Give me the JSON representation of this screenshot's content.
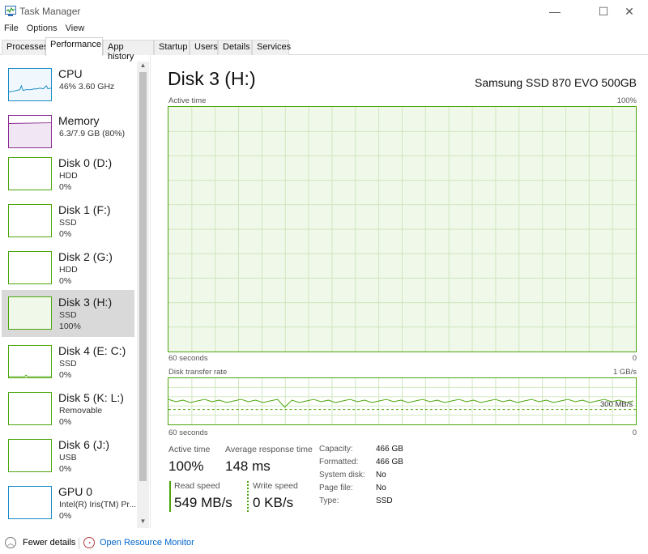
{
  "window": {
    "title": "Task Manager",
    "controls": {
      "minimize": "—",
      "maximize": "☐",
      "close": "✕"
    }
  },
  "menu": [
    "File",
    "Options",
    "View"
  ],
  "tabs": [
    "Processes",
    "Performance",
    "App history",
    "Startup",
    "Users",
    "Details",
    "Services"
  ],
  "active_tab": "Performance",
  "sidebar": {
    "items": [
      {
        "name": "CPU",
        "sub1": "46%  3.60 GHz",
        "sub2": ""
      },
      {
        "name": "Memory",
        "sub1": "6.3/7.9 GB (80%)",
        "sub2": ""
      },
      {
        "name": "Disk 0 (D:)",
        "sub1": "HDD",
        "sub2": "0%"
      },
      {
        "name": "Disk 1 (F:)",
        "sub1": "SSD",
        "sub2": "0%"
      },
      {
        "name": "Disk 2 (G:)",
        "sub1": "HDD",
        "sub2": "0%"
      },
      {
        "name": "Disk 3 (H:)",
        "sub1": "SSD",
        "sub2": "100%"
      },
      {
        "name": "Disk 4 (E: C:)",
        "sub1": "SSD",
        "sub2": "0%"
      },
      {
        "name": "Disk 5 (K: L:)",
        "sub1": "Removable",
        "sub2": "0%"
      },
      {
        "name": "Disk 6 (J:)",
        "sub1": "USB",
        "sub2": "0%"
      },
      {
        "name": "GPU 0",
        "sub1": "Intel(R) Iris(TM) Pr...",
        "sub2": "0%"
      }
    ],
    "selected": "Disk 3 (H:)"
  },
  "main": {
    "title": "Disk 3 (H:)",
    "model": "Samsung SSD 870 EVO 500GB",
    "active_graph": {
      "label": "Active time",
      "max": "100%",
      "time": "60 seconds",
      "min": "0",
      "level": 1.0
    },
    "transfer_graph": {
      "label": "Disk transfer rate",
      "max": "1 GB/s",
      "marker": "300 MB/s",
      "time": "60 seconds",
      "min": "0"
    },
    "stats": {
      "active_time_label": "Active time",
      "active_time": "100%",
      "avg_response_label": "Average response time",
      "avg_response": "148 ms",
      "read_label": "Read speed",
      "read": "549 MB/s",
      "write_label": "Write speed",
      "write": "0 KB/s"
    },
    "properties": [
      {
        "key": "Capacity:",
        "value": "466 GB"
      },
      {
        "key": "Formatted:",
        "value": "466 GB"
      },
      {
        "key": "System disk:",
        "value": "No"
      },
      {
        "key": "Page file:",
        "value": "No"
      },
      {
        "key": "Type:",
        "value": "SSD"
      }
    ]
  },
  "footer": {
    "fewer_details": "Fewer details",
    "resource_monitor": "Open Resource Monitor"
  },
  "colors": {
    "disk_green": "#4ca60c",
    "graph_fill": "#f0f8ea",
    "memory_purple": "#8b2c93",
    "cpu_blue": "#1a8bc9",
    "link_blue": "#0066cc"
  }
}
